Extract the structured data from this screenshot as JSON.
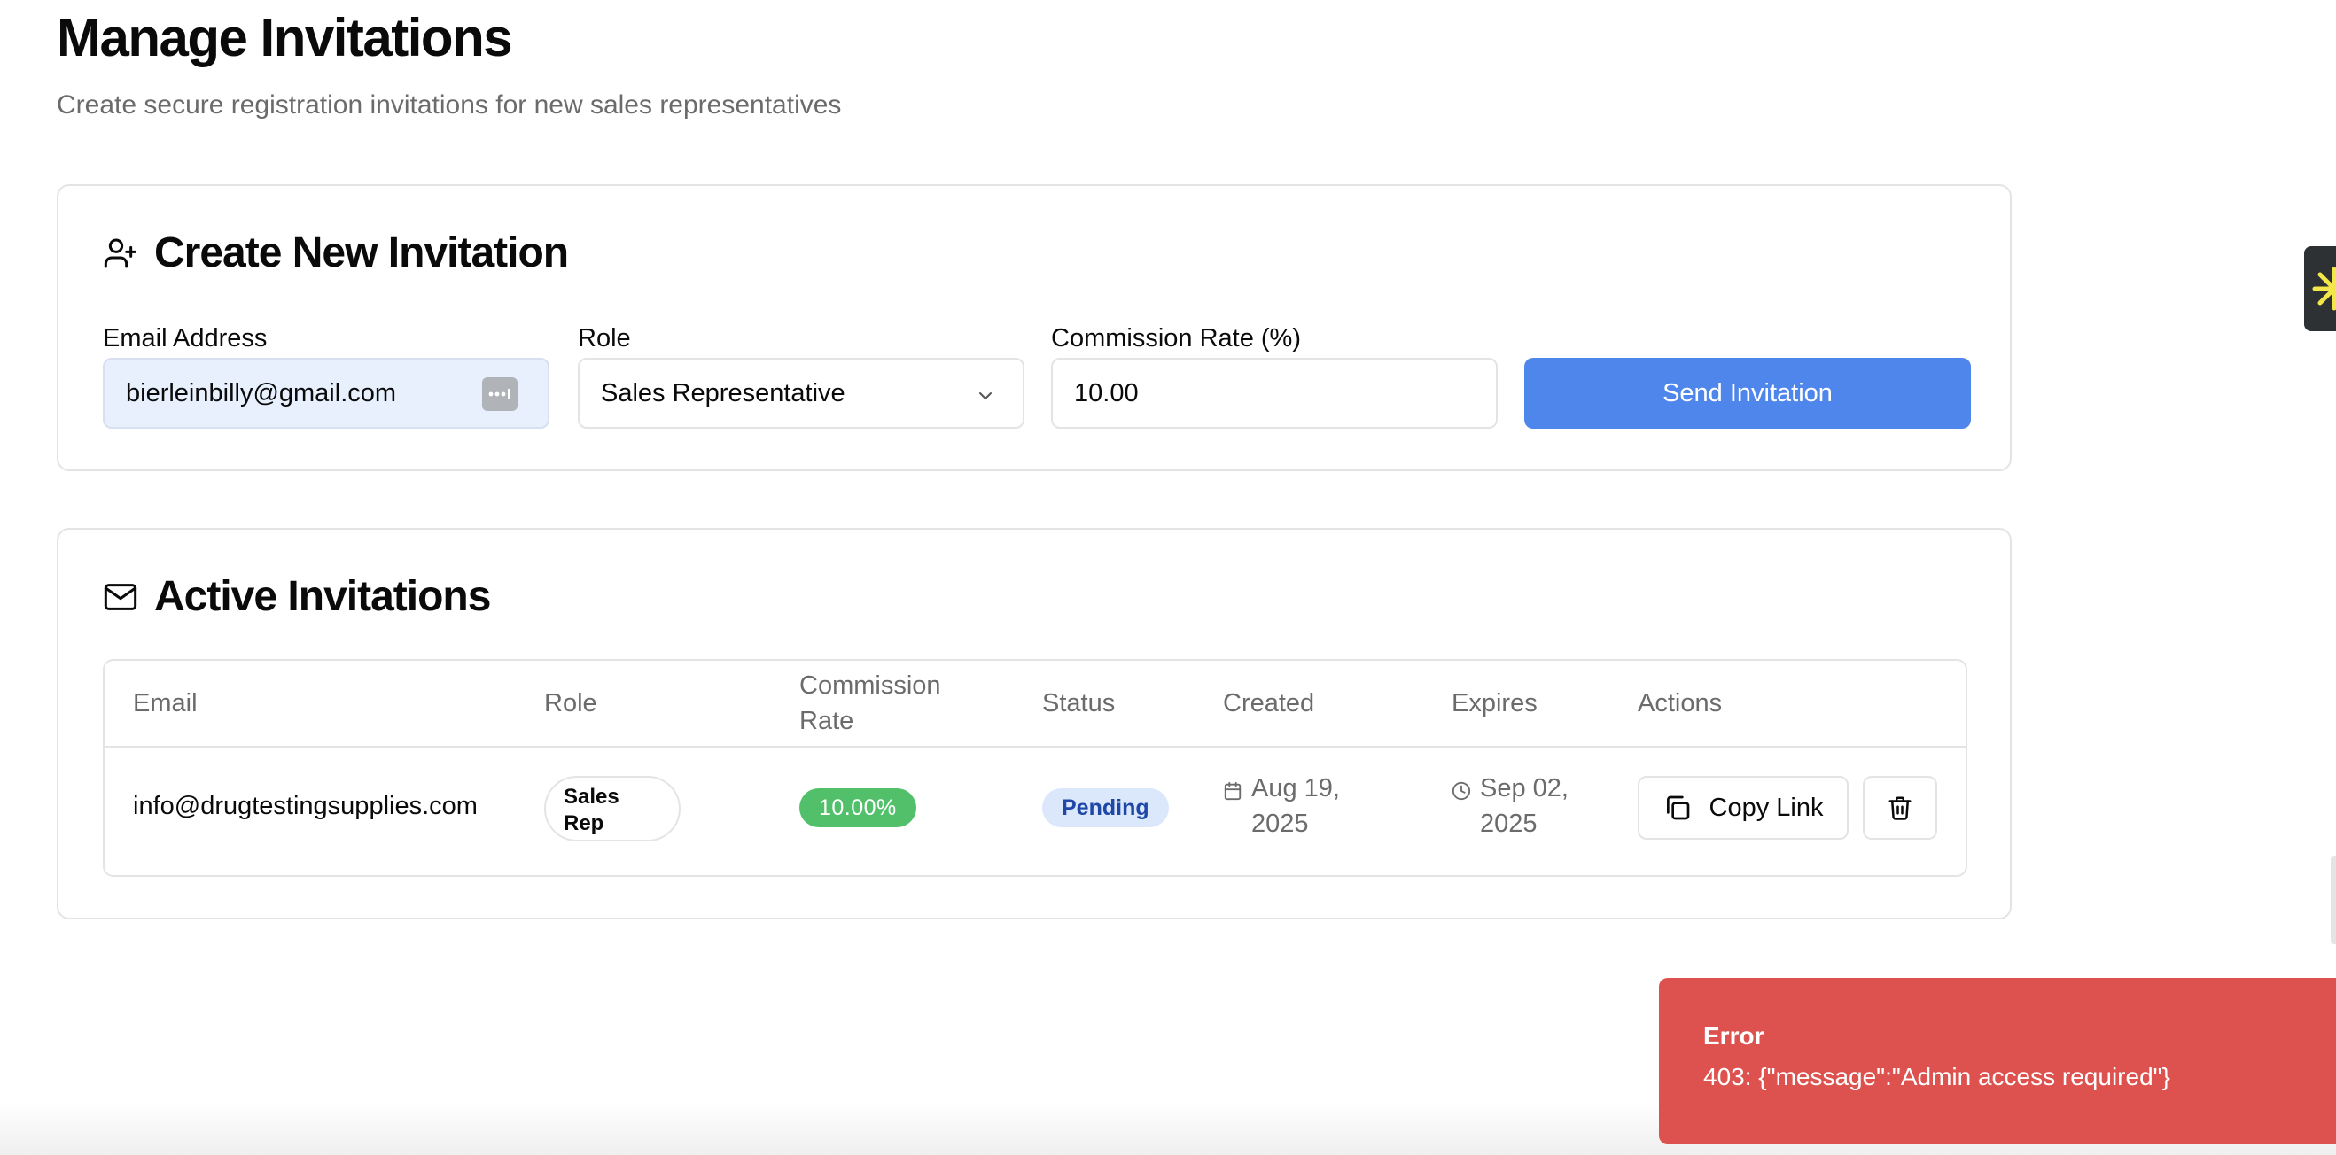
{
  "header": {
    "title": "Manage Invitations",
    "subtitle": "Create secure registration invitations for new sales representatives"
  },
  "create_card": {
    "title": "Create New Invitation",
    "icon": "user-plus-icon",
    "email_label": "Email Address",
    "email_value": "bierleinbilly@gmail.com",
    "role_label": "Role",
    "role_value": "Sales Representative",
    "commission_label": "Commission Rate (%)",
    "commission_value": "10.00",
    "send_label": "Send Invitation"
  },
  "active_card": {
    "title": "Active Invitations",
    "icon": "mail-icon",
    "columns": {
      "email": "Email",
      "role": "Role",
      "commission_line1": "Commission",
      "commission_line2": "Rate",
      "status": "Status",
      "created": "Created",
      "expires": "Expires",
      "actions": "Actions"
    },
    "rows": [
      {
        "email": "info@drugtestingsupplies.com",
        "role_line1": "Sales",
        "role_line2": "Rep",
        "rate": "10.00%",
        "status": "Pending",
        "created_line1": "Aug 19,",
        "created_line2": "2025",
        "expires_line1": "Sep 02,",
        "expires_line2": "2025",
        "copy_label": "Copy Link"
      }
    ]
  },
  "toast": {
    "title": "Error",
    "message": "403: {\"message\":\"Admin access required\"}"
  },
  "colors": {
    "primary": "#4f86ec",
    "error": "#dd524f",
    "success": "#52c06a",
    "pending_bg": "#dbe8fb",
    "pending_text": "#1e47a8"
  }
}
